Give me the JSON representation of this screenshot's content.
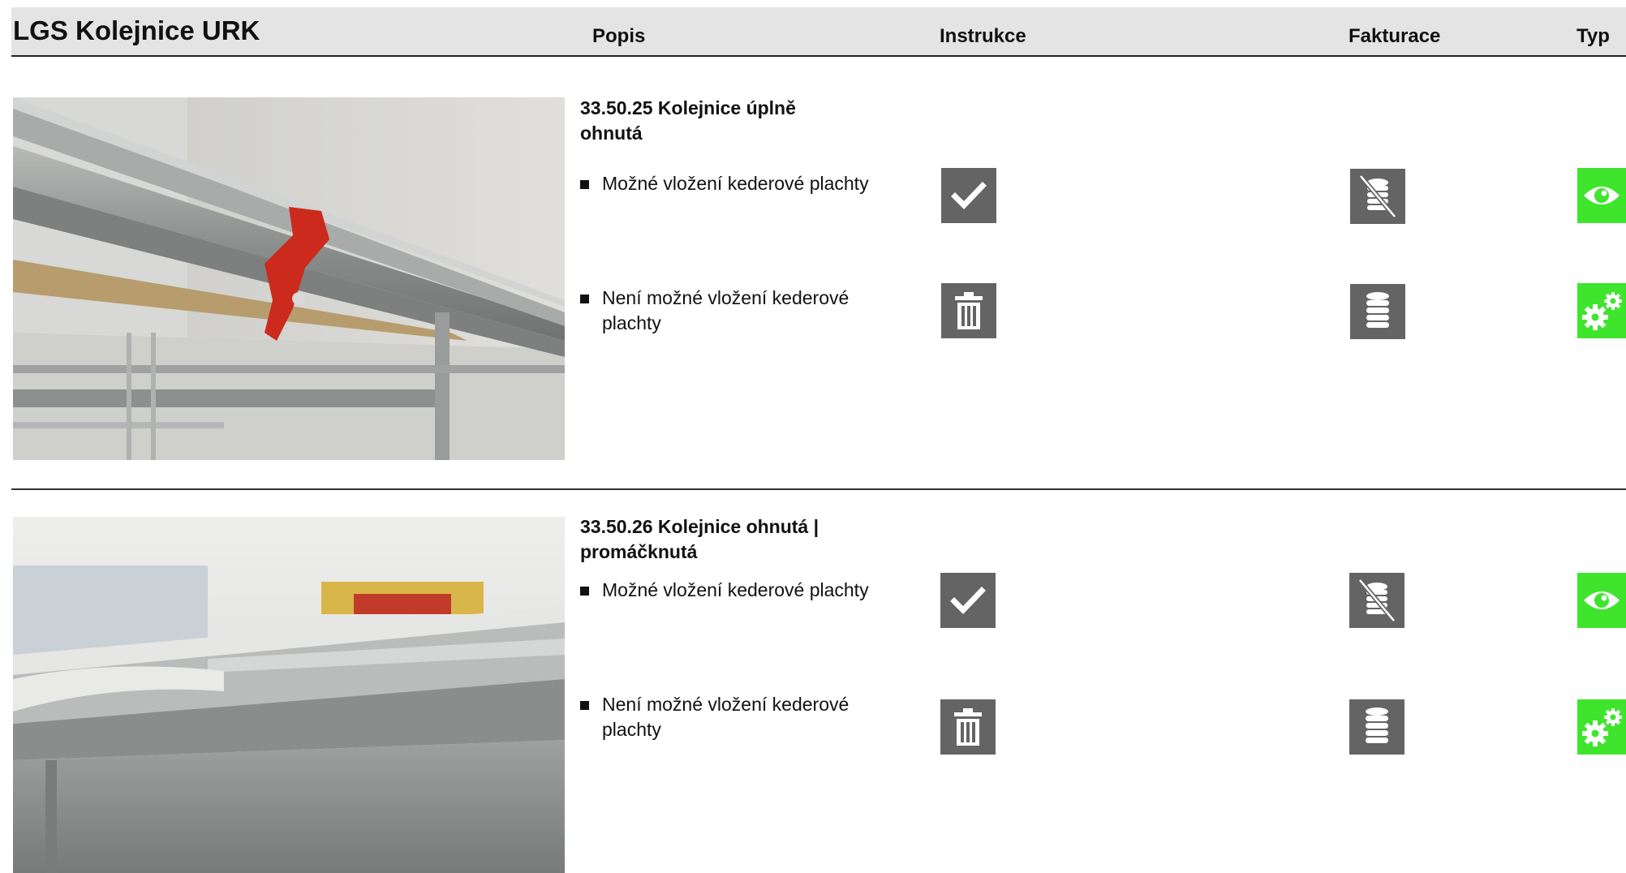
{
  "header": {
    "title": "LGS Kolejnice URK",
    "columns": {
      "popis": "Popis",
      "instrukce": "Instrukce",
      "fakturace": "Fakturace",
      "typ": "Typ"
    }
  },
  "items": [
    {
      "title": "33.50.25 Kolejnice úplně ohnutá",
      "rows": [
        {
          "text": "Možné vložení kederové plachty",
          "instruction_icon": "checkmark-icon",
          "billing_icon": "no-billing-coins-icon",
          "type_icon": "eye-icon"
        },
        {
          "text": "Není možné vložení kederové plachty",
          "instruction_icon": "trash-icon",
          "billing_icon": "coins-stack-icon",
          "type_icon": "gears-icon"
        }
      ]
    },
    {
      "title": "33.50.26 Kolejnice ohnutá | promáčknutá",
      "rows": [
        {
          "text": "Možné vložení kederové plachty",
          "instruction_icon": "checkmark-icon",
          "billing_icon": "no-billing-coins-icon",
          "type_icon": "eye-icon"
        },
        {
          "text": "Není možné vložení kederové plachty",
          "instruction_icon": "trash-icon",
          "billing_icon": "coins-stack-icon",
          "type_icon": "gears-icon"
        }
      ]
    }
  ],
  "colors": {
    "icon_gray": "#646464",
    "icon_green": "#3fe52d",
    "header_bg": "#e4e4e4"
  }
}
